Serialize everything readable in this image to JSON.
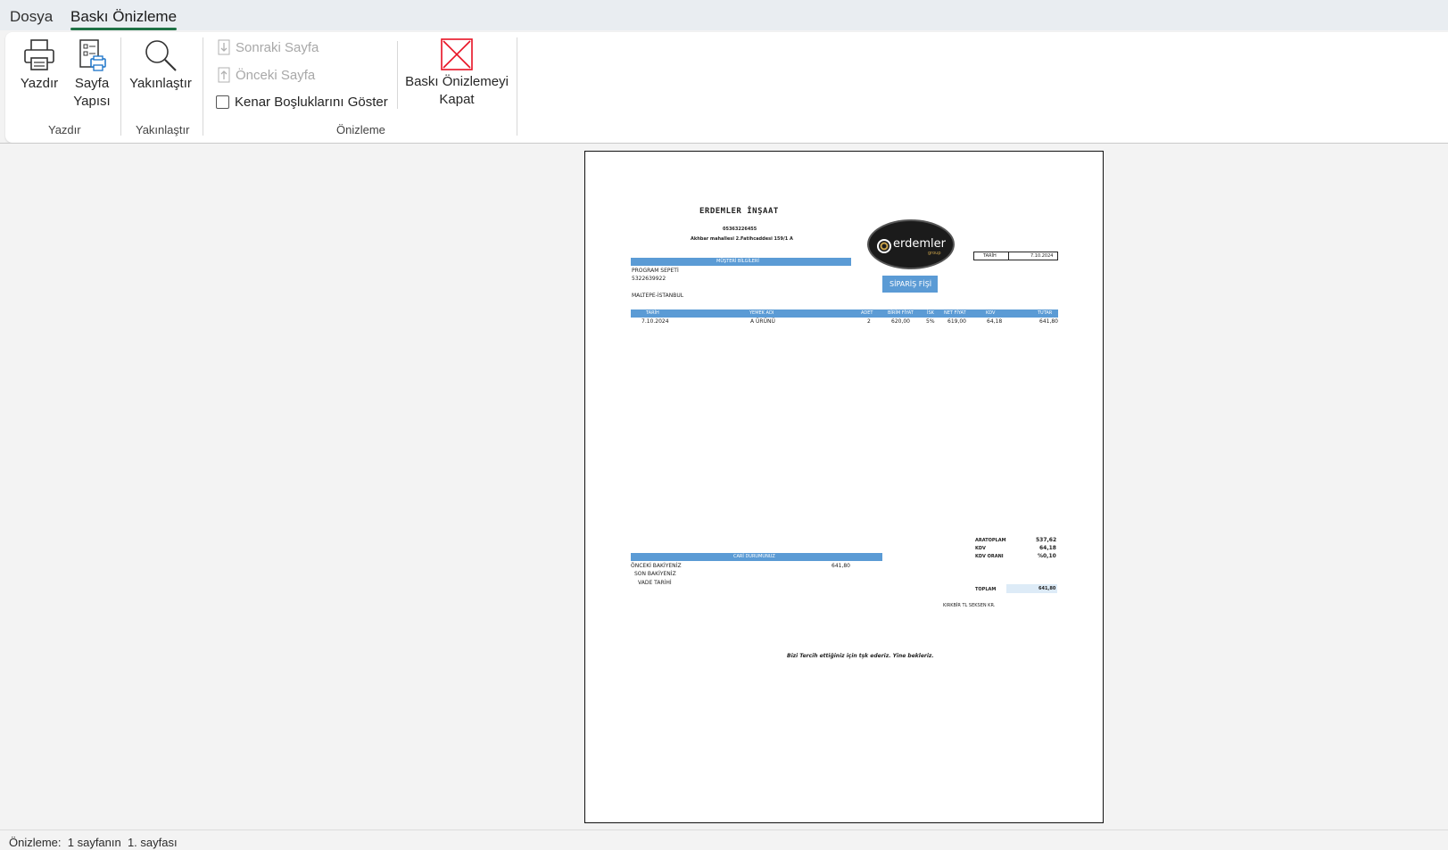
{
  "tabs": {
    "file": "Dosya",
    "print_preview": "Baskı Önizleme"
  },
  "ribbon": {
    "print": "Yazdır",
    "page_setup_line1": "Sayfa",
    "page_setup_line2": "Yapısı",
    "zoom": "Yakınlaştır",
    "next_page": "Sonraki Sayfa",
    "prev_page": "Önceki Sayfa",
    "show_margins": "Kenar Boşluklarını Göster",
    "close_line1": "Baskı Önizlemeyi",
    "close_line2": "Kapat",
    "groups": {
      "print": "Yazdır",
      "zoom": "Yakınlaştır",
      "preview": "Önizleme"
    }
  },
  "document": {
    "company": "ERDEMLER İNŞAAT",
    "phone": "05363226455",
    "address": "Akhbar mahallesi 2.Fatihcaddesi 159/1 A",
    "logo_text": "erdemler",
    "logo_sub": "group",
    "date_label": "TARİH",
    "date_value": "7.10.2024",
    "customer_header": "MÜŞTERİ BİLGİLERİ",
    "customer_name": "PROGRAM SEPETİ",
    "customer_phone": "5322639922",
    "customer_city": "MALTEPE-İSTANBUL",
    "order_badge": "SİPARİŞ FİŞİ",
    "columns": [
      "TARİH",
      "YEMEK ADI",
      "ADET",
      "BİRİM FİYAT",
      "İSK",
      "NET FİYAT",
      "KDV",
      "TUTAR"
    ],
    "rows": [
      {
        "date": "7.10.2024",
        "name": "A ÜRÜNÜ",
        "qty": "2",
        "unit": "620,00",
        "disc": "5%",
        "net": "619,00",
        "vat": "64,18",
        "total": "641,80"
      }
    ],
    "account_header": "CARİ DURUMUNUZ",
    "prev_balance_label": "ÖNCEKİ BAKİYENİZ",
    "prev_balance_value": "641,80",
    "last_balance_label": "SON BAKİYENİZ",
    "due_date_label": "VADE TARİHİ",
    "subtotal_label": "ARATOPLAM",
    "subtotal_value": "537,62",
    "vat_label": "KDV",
    "vat_value": "64,18",
    "vat_rate_label": "KDV ORANI",
    "vat_rate_value": "%0,10",
    "total_label": "TOPLAM",
    "total_value": "641,80",
    "amount_words": "KIRKBİR TL SEKSEN KR.",
    "thanks": "Bizi Tercih ettiğiniz için tşk ederiz. Yine bekleriz."
  },
  "status": {
    "text": "Önizleme:  1 sayfanın  1. sayfası"
  },
  "colors": {
    "accent_green": "#1e7145",
    "table_blue": "#5b9bd5",
    "close_red": "#e81123",
    "total_fill": "#ddebf7"
  }
}
